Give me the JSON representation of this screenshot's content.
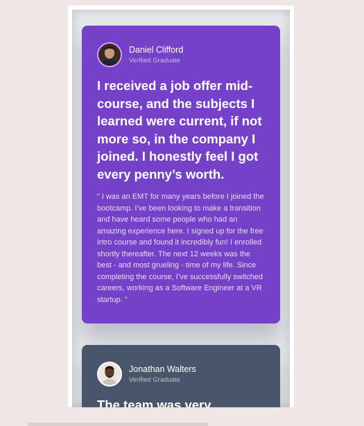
{
  "testimonials": [
    {
      "name": "Daniel Clifford",
      "role": "Verified Graduate",
      "headline": "I received a job offer mid-course, and the subjects I learned were current, if not more so, in the company I joined. I honestly feel I got every penny’s worth.",
      "quote": "“ I was an EMT for many years before I joined the bootcamp. I’ve been looking to make a transition and have heard some people who had an amazing experience here. I signed up for the free intro course and found it incredibly fun! I enrolled shortly thereafter. The next 12 weeks was the best - and most grueling - time of my life. Since completing the course, I’ve successfully switched careers, working as a Software Engineer at a VR startup. ”",
      "color": "#7541c8"
    },
    {
      "name": "Jonathan Walters",
      "role": "Verified Graduate",
      "headline": "The team was very",
      "color": "#48556a"
    }
  ]
}
